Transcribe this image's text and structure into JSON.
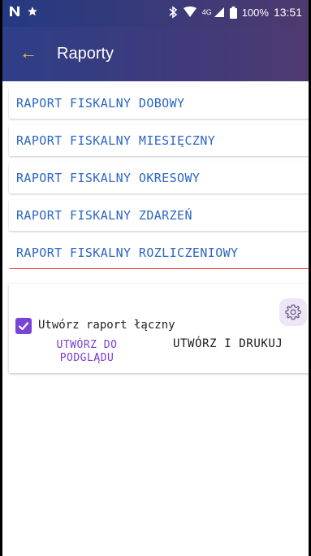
{
  "status_bar": {
    "left_icons": [
      "n-icon",
      "star-icon"
    ],
    "right_icons": [
      "bluetooth-icon",
      "wifi-icon",
      "signal-4g-icon",
      "battery-icon"
    ],
    "network": "4G",
    "battery": "100%",
    "time": "13:51"
  },
  "appbar": {
    "title": "Raporty",
    "back_icon": "arrow-left-icon"
  },
  "colors": {
    "appbar_gradient_start": "#2d3f88",
    "appbar_gradient_end": "#4f3a70",
    "report_text": "#2b66c3",
    "accent_purple": "#7a45d6",
    "active_underline": "#e53935",
    "back_arrow": "#f0c050"
  },
  "reports": [
    {
      "label": "RAPORT FISKALNY DOBOWY"
    },
    {
      "label": "RAPORT FISKALNY MIESIĘCZNY"
    },
    {
      "label": "RAPORT FISKALNY OKRESOWY"
    },
    {
      "label": "RAPORT FISKALNY ZDARZEŃ"
    },
    {
      "label": "RAPORT FISKALNY ROZLICZENIOWY"
    }
  ],
  "options": {
    "combined_checkbox_label": "Utwórz raport łączny",
    "combined_checked": true,
    "settings_icon": "gear-icon",
    "preview_button_line1": "UTWÓRZ DO",
    "preview_button_line2": "PODGLĄDU",
    "print_button": "UTWÓRZ I DRUKUJ"
  }
}
